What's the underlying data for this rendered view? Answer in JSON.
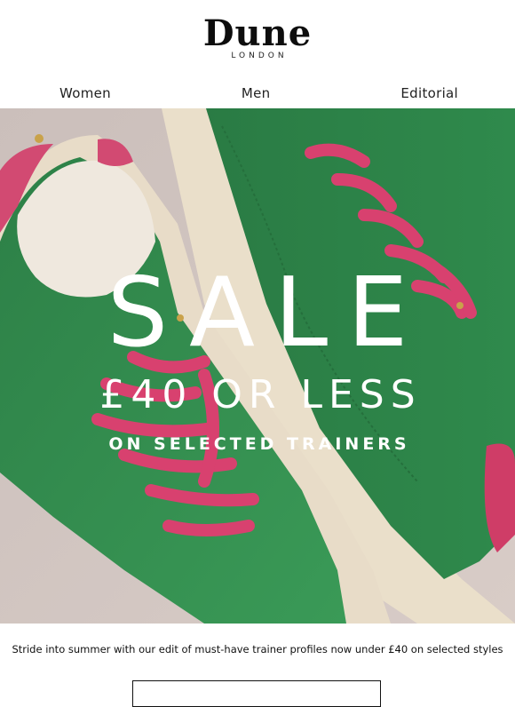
{
  "brand": {
    "name": "Dune",
    "sub": "LONDON"
  },
  "nav": {
    "items": [
      "Women",
      "Men",
      "Editorial"
    ]
  },
  "hero": {
    "headline": "SALE",
    "price_line": "£40 OR LESS",
    "sub_line": "ON SELECTED TRAINERS",
    "image": "green-suede-trainers-pink-laces"
  },
  "intro_text": "Stride into summer with our edit of must-have trainer profiles now under £40 on selected styles",
  "colors": {
    "background": "#ffffff",
    "hero_bg": "#d2c6c2",
    "shoe_green": "#2f8a4c",
    "lace_pink": "#d8416f",
    "sole_cream": "#eadfca",
    "text": "#111111"
  }
}
